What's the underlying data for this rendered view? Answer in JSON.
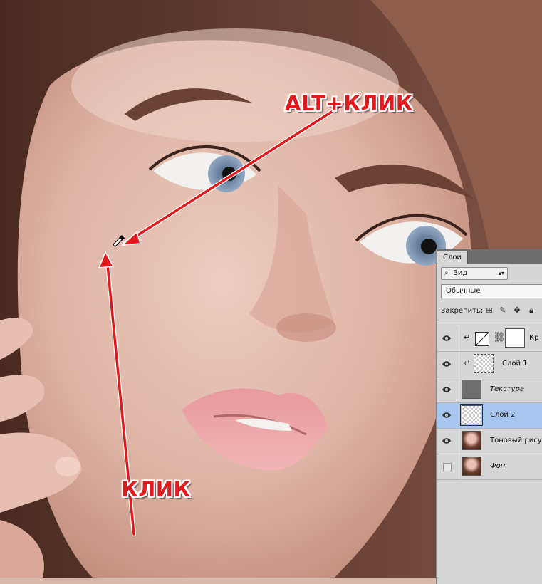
{
  "annotations": {
    "top_label": "ALT+КЛИК",
    "bottom_label": "КЛИК",
    "arrow_color": "#e1181c",
    "cursor_icon": "eyedropper-icon"
  },
  "layers_panel": {
    "tab_label": "Слои",
    "filter_kind": "Вид",
    "blend_mode": "Обычные",
    "lock_label": "Закрепить:",
    "lock_icons": [
      "lock-transparency-icon",
      "lock-paint-icon",
      "lock-move-icon",
      "lock-all-icon"
    ],
    "layers": [
      {
        "name": "Кр",
        "visible": true,
        "type": "curves-adjustment",
        "clipped": true,
        "selected": false
      },
      {
        "name": "Слой 1",
        "visible": true,
        "type": "pixel",
        "clipped": true,
        "selected": false
      },
      {
        "name": "Текстура",
        "visible": true,
        "type": "pixel",
        "clipped": false,
        "selected": false
      },
      {
        "name": "Слой 2",
        "visible": true,
        "type": "pixel",
        "clipped": false,
        "selected": true
      },
      {
        "name": "Тоновый рисунок",
        "visible": true,
        "type": "pixel",
        "clipped": false,
        "selected": false
      },
      {
        "name": "Фон",
        "visible": false,
        "type": "background",
        "clipped": false,
        "selected": false
      }
    ]
  }
}
